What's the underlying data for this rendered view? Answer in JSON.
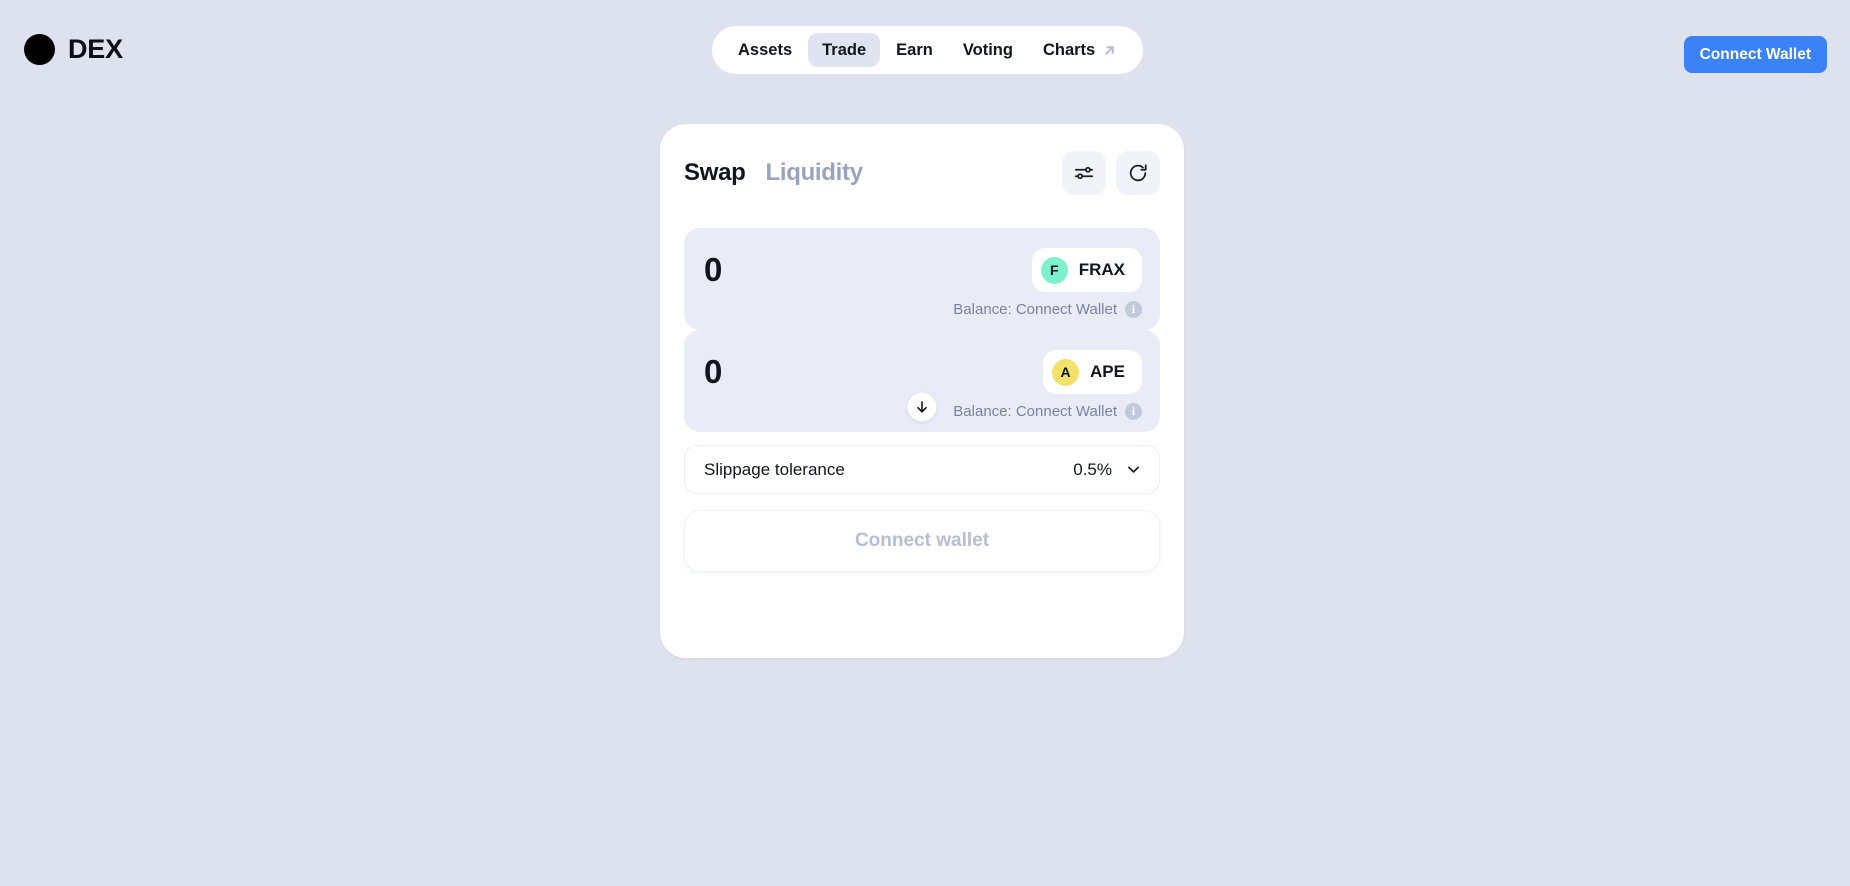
{
  "brand": {
    "name": "DEX",
    "logo_icon": "black-circle-logo",
    "logo_color": "#000000"
  },
  "nav": {
    "items": [
      {
        "label": "Assets",
        "active": false,
        "external": false
      },
      {
        "label": "Trade",
        "active": true,
        "external": false
      },
      {
        "label": "Earn",
        "active": false,
        "external": false
      },
      {
        "label": "Voting",
        "active": false,
        "external": false
      },
      {
        "label": "Charts",
        "active": false,
        "external": true,
        "icon": "external-link-arrow-icon"
      }
    ]
  },
  "header": {
    "connect_wallet_label": "Connect Wallet",
    "connect_wallet_color": "#3b82f6"
  },
  "swap_card": {
    "tabs": [
      {
        "label": "Swap",
        "active": true
      },
      {
        "label": "Liquidity",
        "active": false
      }
    ],
    "actions": [
      {
        "name": "settings-button",
        "icon": "sliders-icon"
      },
      {
        "name": "refresh-button",
        "icon": "refresh-icon"
      }
    ],
    "fields": [
      {
        "amount": "0",
        "placeholder": "0",
        "token_symbol": "FRAX",
        "token_initial": "F",
        "token_color": "#7df0cc",
        "balance": "Balance: Connect Wallet",
        "info_glyph": "i"
      },
      {
        "amount": "0",
        "placeholder": "0",
        "token_symbol": "APE",
        "token_initial": "A",
        "token_color": "#f2e26b",
        "balance": "Balance: Connect Wallet",
        "info_glyph": "i"
      }
    ],
    "swap_direction_icon": "arrow-down-icon",
    "slippage": {
      "label": "Slippage tolerance",
      "value": "0.5%",
      "chevron_icon": "chevron-down-icon"
    },
    "cta": {
      "label": "Connect wallet",
      "disabled": true
    }
  },
  "theme": {
    "page_background": "#dde2ee",
    "card_background": "#ffffff",
    "field_background": "#e9ecf6",
    "muted_text": "#79839e",
    "accent": "#3b82f6"
  }
}
